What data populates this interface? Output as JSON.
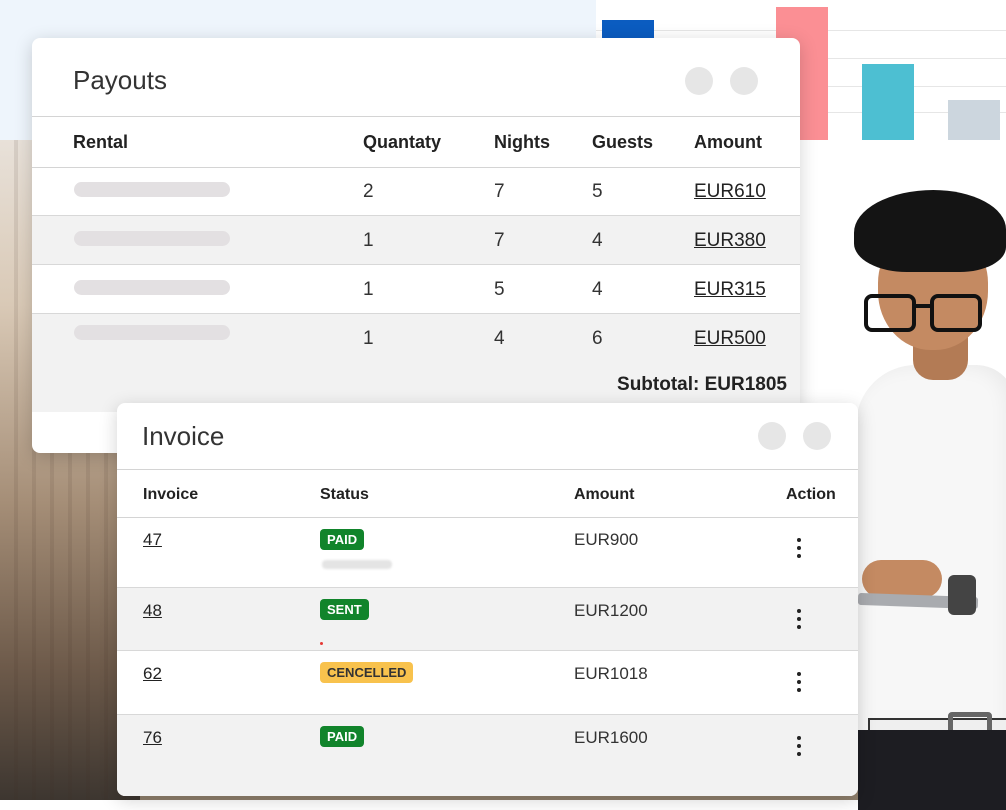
{
  "colors": {
    "chart_blue": "#0b5cc0",
    "chart_pink": "#fb8f94",
    "chart_teal": "#4dbfd2",
    "chart_grey": "#ccd6de",
    "badge_green": "#11842b",
    "badge_amber": "#f8c24d"
  },
  "payouts": {
    "title": "Payouts",
    "columns": [
      "Rental",
      "Quantaty",
      "Nights",
      "Guests",
      "Amount"
    ],
    "rows": [
      {
        "quantity": "2",
        "nights": "7",
        "guests": "5",
        "amount": "EUR610"
      },
      {
        "quantity": "1",
        "nights": "7",
        "guests": "4",
        "amount": "EUR380"
      },
      {
        "quantity": "1",
        "nights": "5",
        "guests": "4",
        "amount": "EUR315"
      },
      {
        "quantity": "1",
        "nights": "4",
        "guests": "6",
        "amount": "EUR500"
      }
    ],
    "subtotal": "Subtotal: EUR1805"
  },
  "invoice": {
    "title": "Invoice",
    "columns": [
      "Invoice",
      "Status",
      "Amount",
      "Action"
    ],
    "rows": [
      {
        "number": "47",
        "status": "PAID",
        "amount": "EUR900",
        "action_icon": "kebab-menu-icon"
      },
      {
        "number": "48",
        "status": "SENT",
        "amount": "EUR1200",
        "action_icon": "kebab-menu-icon"
      },
      {
        "number": "62",
        "status": "CENCELLED",
        "amount": "EUR1018",
        "action_icon": "kebab-menu-icon"
      },
      {
        "number": "76",
        "status": "PAID",
        "amount": "EUR1600",
        "action_icon": "kebab-menu-icon"
      }
    ]
  }
}
